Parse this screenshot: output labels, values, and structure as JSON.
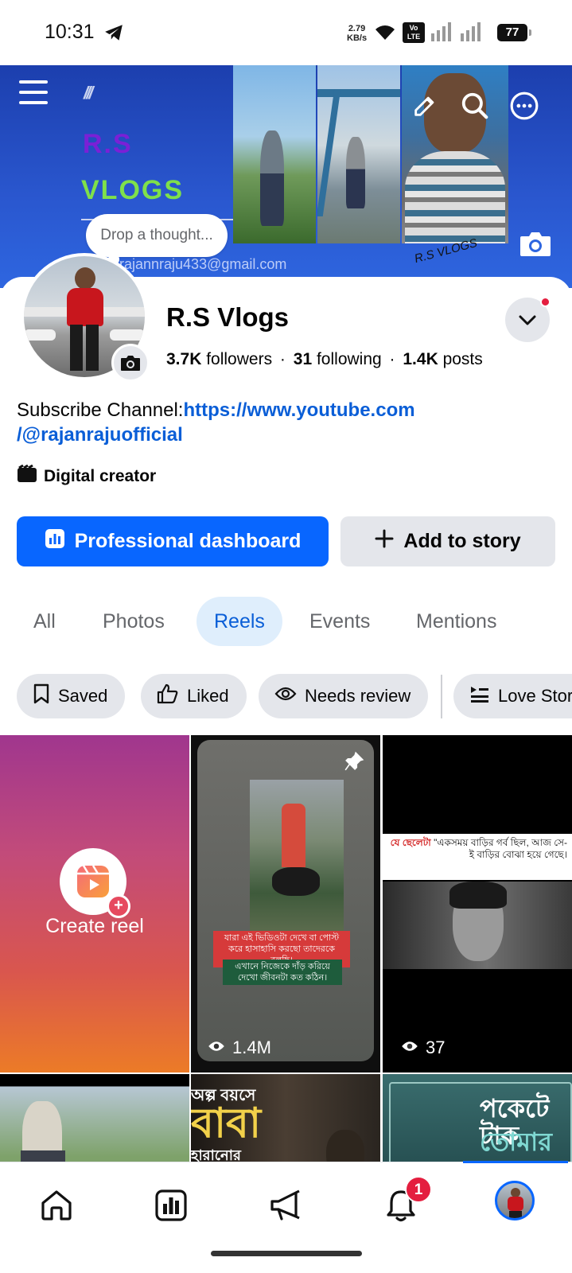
{
  "status_bar": {
    "time": "10:31",
    "speed_value": "2.79",
    "speed_unit": "KB/s",
    "lte_label": "LTE",
    "vo_label": "Vo",
    "battery": "77"
  },
  "cover": {
    "logo_slashes": "///",
    "logo_line1": "R.S",
    "logo_line2": "VLOGS",
    "email_partial": "rajannraju433@gmail.com",
    "signature": "R.S VLOGS",
    "thought_placeholder": "Drop a thought..."
  },
  "profile": {
    "name": "R.S Vlogs",
    "followers_count": "3.7K",
    "followers_label": "followers",
    "following_count": "31",
    "following_label": "following",
    "posts_count": "1.4K",
    "posts_label": "posts",
    "separator": "·",
    "bio_prefix": "Subscribe Channel:",
    "bio_link_line1": "https://www.youtube.com",
    "bio_link_line2": "/@rajanrajuofficial",
    "category": "Digital creator"
  },
  "actions": {
    "dashboard_label": "Professional dashboard",
    "story_label": "Add to story"
  },
  "tabs": [
    {
      "label": "All"
    },
    {
      "label": "Photos"
    },
    {
      "label": "Reels",
      "active": true
    },
    {
      "label": "Events"
    },
    {
      "label": "Mentions"
    }
  ],
  "chips": [
    {
      "label": "Saved",
      "icon": "bookmark-icon"
    },
    {
      "label": "Liked",
      "icon": "thumbs-up-icon"
    },
    {
      "label": "Needs review",
      "icon": "eye-icon"
    },
    {
      "label": "Love Stor",
      "icon": "playlist-icon"
    }
  ],
  "reels": {
    "create_label": "Create reel",
    "reel1_views": "1.4M",
    "reel1_caption1": "যারা এই ভিডিওটা দেখে বা পোস্ট করে হাসাহাসি করছো তাদেরকে বলছি।",
    "reel1_caption2": "এখানে নিজেকে দাঁড় করিয়ে দেখো জীবনটা কত কঠিন।",
    "reel2_views": "37",
    "reel2_caption_red": "যে ছেলেটা",
    "reel2_caption": "\"একসময় বাড়ির গর্ব ছিল, আজ সে-ই বাড়ির বোঝা হয়ে গেছে।",
    "reel4_line1": "অল্প বয়সে",
    "reel4_line2": "বাবা",
    "reel4_line3": "হারানোর",
    "reel5_line1": "পকেটে টাক",
    "reel5_line2": "তোমার অ"
  },
  "nav": {
    "notifications_badge": "1"
  },
  "colors": {
    "accent": "#0866ff",
    "link": "#0a5ed7",
    "badge": "#e41e3f"
  }
}
